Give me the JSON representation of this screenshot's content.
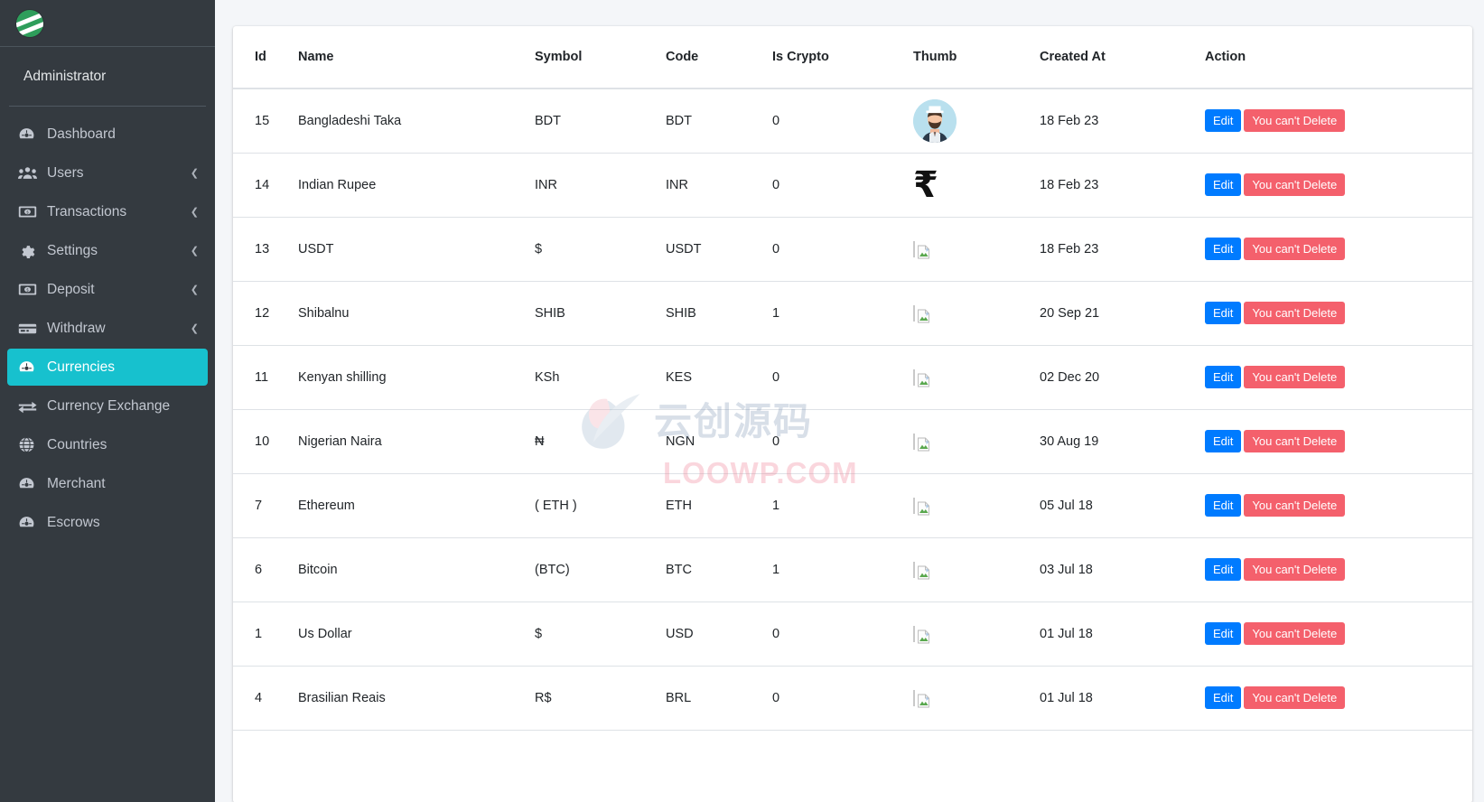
{
  "sidebar": {
    "logo_icon": "app-logo-green-circle",
    "user_label": "Administrator",
    "items": [
      {
        "label": "Dashboard",
        "icon": "dashboard-icon",
        "has_arrow": false,
        "active": false
      },
      {
        "label": "Users",
        "icon": "users-icon",
        "has_arrow": true,
        "active": false
      },
      {
        "label": "Transactions",
        "icon": "money-bill-icon",
        "has_arrow": true,
        "active": false
      },
      {
        "label": "Settings",
        "icon": "gear-icon",
        "has_arrow": true,
        "active": false
      },
      {
        "label": "Deposit",
        "icon": "money-bill-icon",
        "has_arrow": true,
        "active": false
      },
      {
        "label": "Withdraw",
        "icon": "credit-card-icon",
        "has_arrow": true,
        "active": false
      },
      {
        "label": "Currencies",
        "icon": "dashboard-icon",
        "has_arrow": false,
        "active": true
      },
      {
        "label": "Currency Exchange",
        "icon": "exchange-arrows-icon",
        "has_arrow": false,
        "active": false
      },
      {
        "label": "Countries",
        "icon": "globe-icon",
        "has_arrow": false,
        "active": false
      },
      {
        "label": "Merchant",
        "icon": "dashboard-icon",
        "has_arrow": false,
        "active": false
      },
      {
        "label": "Escrows",
        "icon": "dashboard-icon",
        "has_arrow": false,
        "active": false
      }
    ],
    "arrow_glyph": "❮"
  },
  "table": {
    "columns": [
      "Id",
      "Name",
      "Symbol",
      "Code",
      "Is Crypto",
      "Thumb",
      "Created At",
      "Action"
    ],
    "rows": [
      {
        "id": "15",
        "name": "Bangladeshi Taka",
        "symbol": "BDT",
        "code": "BDT",
        "is_crypto": "0",
        "thumb": "avatar",
        "created_at": "18 Feb 23"
      },
      {
        "id": "14",
        "name": "Indian Rupee",
        "symbol": "INR",
        "code": "INR",
        "is_crypto": "0",
        "thumb": "rupee",
        "created_at": "18 Feb 23"
      },
      {
        "id": "13",
        "name": "USDT",
        "symbol": "$",
        "code": "USDT",
        "is_crypto": "0",
        "thumb": "broken",
        "created_at": "18 Feb 23"
      },
      {
        "id": "12",
        "name": "Shibalnu",
        "symbol": "SHIB",
        "code": "SHIB",
        "is_crypto": "1",
        "thumb": "broken",
        "created_at": "20 Sep 21"
      },
      {
        "id": "11",
        "name": "Kenyan shilling",
        "symbol": "KSh",
        "code": "KES",
        "is_crypto": "0",
        "thumb": "broken",
        "created_at": "02 Dec 20"
      },
      {
        "id": "10",
        "name": "Nigerian Naira",
        "symbol": "₦",
        "code": "NGN",
        "is_crypto": "0",
        "thumb": "broken",
        "created_at": "30 Aug 19"
      },
      {
        "id": "7",
        "name": "Ethereum",
        "symbol": "( ETH )",
        "code": "ETH",
        "is_crypto": "1",
        "thumb": "broken",
        "created_at": "05 Jul 18"
      },
      {
        "id": "6",
        "name": "Bitcoin",
        "symbol": "(BTC)",
        "code": "BTC",
        "is_crypto": "1",
        "thumb": "broken",
        "created_at": "03 Jul 18"
      },
      {
        "id": "1",
        "name": "Us Dollar",
        "symbol": "$",
        "code": "USD",
        "is_crypto": "0",
        "thumb": "broken",
        "created_at": "01 Jul 18"
      },
      {
        "id": "4",
        "name": "Brasilian Reais",
        "symbol": "R$",
        "code": "BRL",
        "is_crypto": "0",
        "thumb": "broken",
        "created_at": "01 Jul 18"
      }
    ],
    "actions": {
      "edit_label": "Edit",
      "delete_label": "You can't Delete"
    }
  },
  "watermark": {
    "cn_text": "云创源码",
    "url_text": "LOOWP.COM",
    "logo_icon": "leaf-watermark-icon"
  },
  "colors": {
    "sidebar_bg": "#343a40",
    "active_item": "#17c1ce",
    "edit_button": "#007bff",
    "delete_button": "#f4606c",
    "page_bg": "#f4f6f9",
    "logo_green": "#2e9e5b"
  }
}
